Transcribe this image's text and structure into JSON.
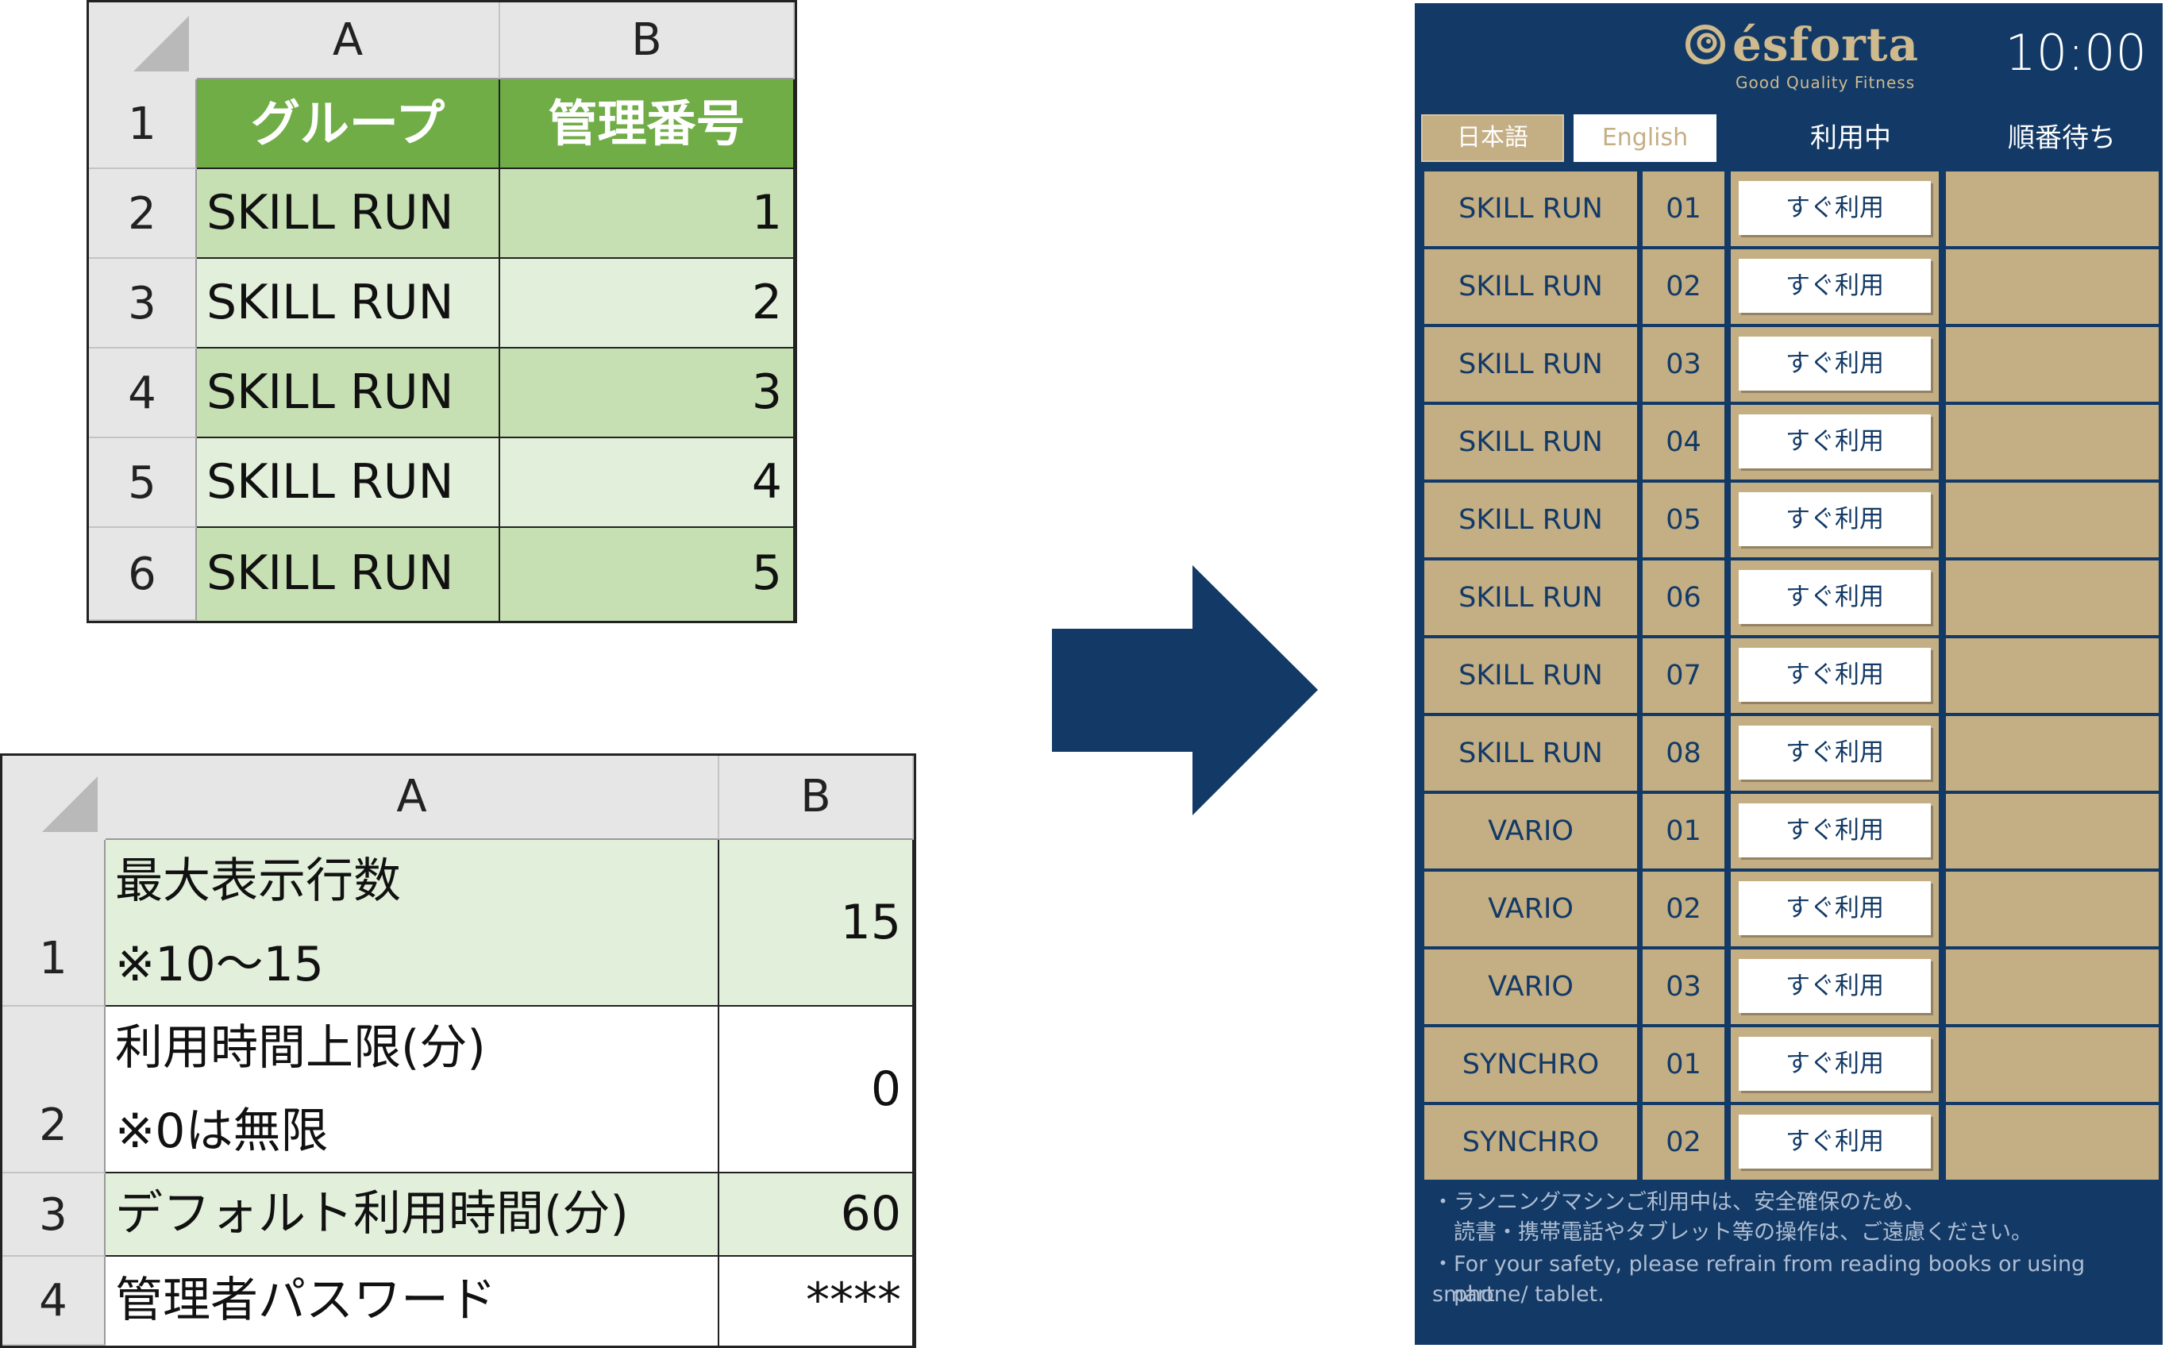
{
  "sheet1": {
    "columns": [
      "A",
      "B"
    ],
    "rows": [
      "1",
      "2",
      "3",
      "4",
      "5",
      "6"
    ],
    "header": [
      "グループ",
      "管理番号"
    ],
    "data": [
      [
        "SKILL RUN",
        "1"
      ],
      [
        "SKILL RUN",
        "2"
      ],
      [
        "SKILL RUN",
        "3"
      ],
      [
        "SKILL RUN",
        "4"
      ],
      [
        "SKILL RUN",
        "5"
      ]
    ]
  },
  "sheet2": {
    "columns": [
      "A",
      "B"
    ],
    "rows": [
      "1",
      "2",
      "3",
      "4"
    ],
    "data": [
      [
        "最大表示行数",
        "※10～15",
        "15"
      ],
      [
        "利用時間上限(分)",
        "※0は無限",
        "0"
      ],
      [
        "デフォルト利用時間(分)",
        "",
        "60"
      ],
      [
        "管理者パスワード",
        "",
        "****"
      ]
    ]
  },
  "app": {
    "brand": "ésforta",
    "tagline": "Good Quality Fitness",
    "clock": "10:00",
    "lang_ja": "日本語",
    "lang_en": "English",
    "col_in_use": "利用中",
    "col_waiting": "順番待ち",
    "use_label": "すぐ利用",
    "machines": [
      {
        "name": "SKILL RUN",
        "no": "01"
      },
      {
        "name": "SKILL RUN",
        "no": "02"
      },
      {
        "name": "SKILL RUN",
        "no": "03"
      },
      {
        "name": "SKILL RUN",
        "no": "04"
      },
      {
        "name": "SKILL RUN",
        "no": "05"
      },
      {
        "name": "SKILL RUN",
        "no": "06"
      },
      {
        "name": "SKILL RUN",
        "no": "07"
      },
      {
        "name": "SKILL RUN",
        "no": "08"
      },
      {
        "name": "VARIO",
        "no": "01"
      },
      {
        "name": "VARIO",
        "no": "02"
      },
      {
        "name": "VARIO",
        "no": "03"
      },
      {
        "name": "SYNCHRO",
        "no": "01"
      },
      {
        "name": "SYNCHRO",
        "no": "02"
      }
    ],
    "notes": [
      "・ランニングマシンご利用中は、安全確保のため、",
      "　読書・携帯電話やタブレット等の操作は、ご遠慮ください。",
      "・For your safety, please refrain from reading books or using smart",
      "　phone/ tablet."
    ]
  },
  "colors": {
    "navy": "#133a66",
    "gold": "#c4ae84",
    "green_header": "#70ad47"
  }
}
